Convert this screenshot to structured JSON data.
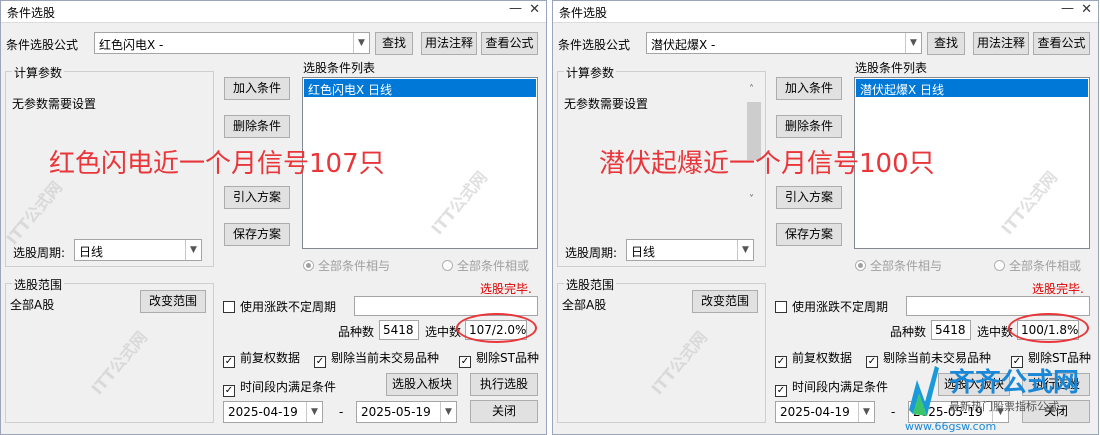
{
  "left": {
    "title": "条件选股",
    "formula_label": "条件选股公式",
    "formula_value": "红色闪电X  -",
    "btn_find": "查找",
    "btn_usage": "用法注释",
    "btn_view": "查看公式",
    "calc_params_title": "计算参数",
    "no_params": "无参数需要设置",
    "cond_list_title": "选股条件列表",
    "cond_item": "红色闪电X  日线",
    "btn_add": "加入条件",
    "btn_delete": "删除条件",
    "btn_import": "引入方案",
    "btn_save": "保存方案",
    "period_label": "选股周期:",
    "period_value": "日线",
    "radio_and": "全部条件相与",
    "radio_or": "全部条件相或",
    "done_text": "选股完毕.",
    "range_title": "选股范围",
    "range_value": "全部A股",
    "btn_change_range": "改变范围",
    "use_change_period": "使用涨跌不定周期",
    "count_label": "品种数",
    "count_value": "5418",
    "selected_label": "选中数",
    "selected_value": "107/2.0%",
    "cb_pre_adjust": "前复权数据",
    "cb_exclude_untraded": "剔除当前未交易品种",
    "cb_exclude_st": "剔除ST品种",
    "cb_time_range": "时间段内满足条件",
    "btn_to_block": "选股入板块",
    "btn_execute": "执行选股",
    "date_from": "2025-04-19",
    "date_sep": "-",
    "date_to": "2025-05-19",
    "btn_close": "关闭",
    "annotation": "红色闪电近一个月信号107只"
  },
  "right": {
    "title": "条件选股",
    "formula_label": "条件选股公式",
    "formula_value": "潜伏起爆X  -",
    "btn_find": "查找",
    "btn_usage": "用法注释",
    "btn_view": "查看公式",
    "calc_params_title": "计算参数",
    "no_params": "无参数需要设置",
    "cond_list_title": "选股条件列表",
    "cond_item": "潜伏起爆X  日线",
    "btn_add": "加入条件",
    "btn_delete": "删除条件",
    "btn_import": "引入方案",
    "btn_save": "保存方案",
    "period_label": "选股周期:",
    "period_value": "日线",
    "radio_and": "全部条件相与",
    "radio_or": "全部条件相或",
    "done_text": "选股完毕.",
    "range_title": "选股范围",
    "range_value": "全部A股",
    "btn_change_range": "改变范围",
    "use_change_period": "使用涨跌不定周期",
    "count_label": "品种数",
    "count_value": "5418",
    "selected_label": "选中数",
    "selected_value": "100/1.8%",
    "cb_pre_adjust": "前复权数据",
    "cb_exclude_untraded": "剔除当前未交易品种",
    "cb_exclude_st": "剔除ST品种",
    "cb_time_range": "时间段内满足条件",
    "btn_to_block": "选股入板块",
    "btn_execute": "执行选股",
    "date_from": "2025-04-19",
    "date_sep": "-",
    "date_to": "2025-05-19",
    "btn_close": "关闭",
    "annotation": "潜伏起爆近一个月信号100只"
  },
  "watermark": {
    "text": "ITT公式网",
    "logo_title": "齐齐公式网",
    "logo_sub": "最新热门股票指标公式",
    "logo_url": "www.66gsw.com"
  },
  "colors": {
    "accent": "#0078d7",
    "annotation": "#e8363a",
    "status": "#e00000"
  }
}
